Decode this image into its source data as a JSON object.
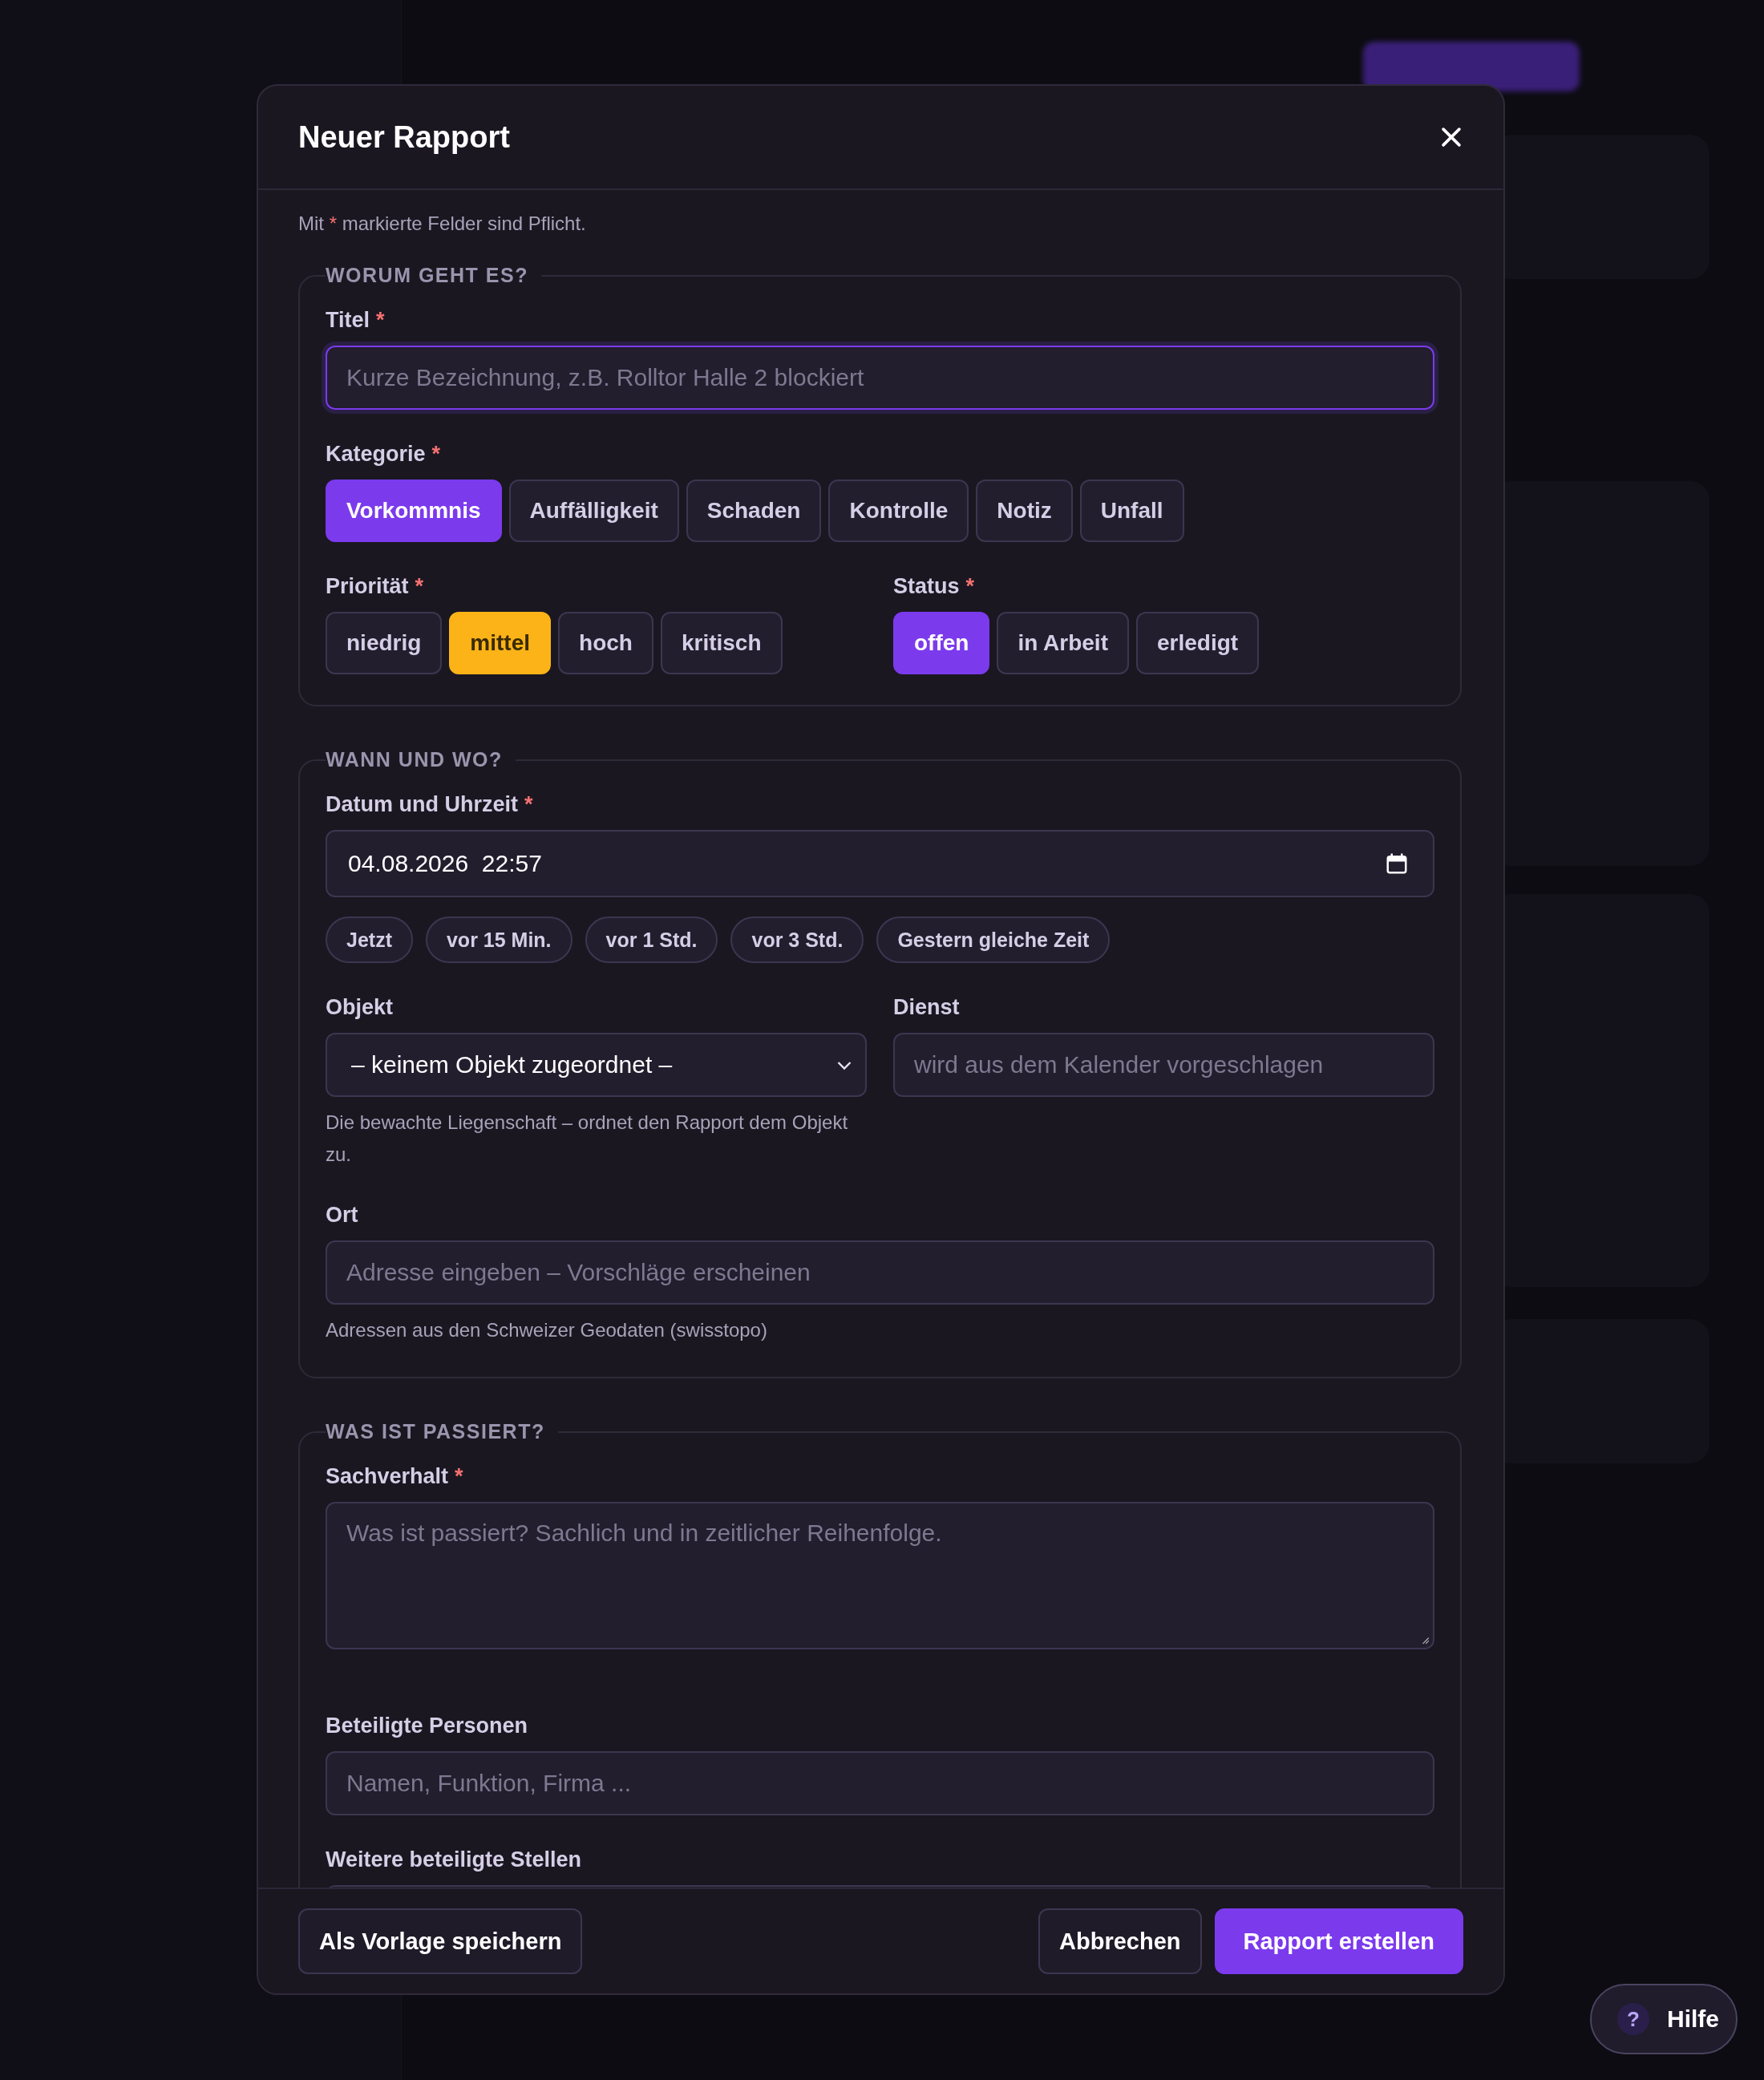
{
  "modal": {
    "title": "Neuer Rapport"
  },
  "required_note": {
    "before": "Mit",
    "mark": "*",
    "after": "markierte Felder sind Pflicht."
  },
  "sections": [
    {
      "legend": "WORUM GEHT ES?",
      "fields": [
        {
          "kind": "input",
          "label": "Titel",
          "required_mark": "*",
          "placeholder": "Kurze Bezeichnung, z.B. Rolltor Halle 2 blockiert",
          "focused": true
        },
        {
          "kind": "chips",
          "label": "Kategorie",
          "required_mark": "*",
          "color": "#7c3aed",
          "options": [
            {
              "label": "Vorkommnis",
              "selected": true
            },
            {
              "label": "Auffälligkeit",
              "selected": false
            },
            {
              "label": "Schaden",
              "selected": false
            },
            {
              "label": "Kontrolle",
              "selected": false
            },
            {
              "label": "Notiz",
              "selected": false
            },
            {
              "label": "Unfall",
              "selected": false
            }
          ]
        },
        {
          "kind": "pair",
          "fields": [
            {
              "kind": "chips",
              "label": "Priorität",
              "required_mark": "*",
              "color": "#fbb318",
              "options": [
                {
                  "label": "niedrig",
                  "selected": false
                },
                {
                  "label": "mittel",
                  "selected": true
                },
                {
                  "label": "hoch",
                  "selected": false
                },
                {
                  "label": "kritisch",
                  "selected": false
                }
              ]
            },
            {
              "kind": "chips",
              "label": "Status",
              "required_mark": "*",
              "color": "#7c3aed",
              "options": [
                {
                  "label": "offen",
                  "selected": true
                },
                {
                  "label": "in Arbeit",
                  "selected": false
                },
                {
                  "label": "erledigt",
                  "selected": false
                }
              ]
            }
          ]
        }
      ]
    },
    {
      "legend": "WANN UND WO?",
      "fields": [
        {
          "kind": "datetime",
          "label": "Datum und Uhrzeit",
          "required_mark": "*",
          "value": "04.08.2026  22:57",
          "presets": [
            "Jetzt",
            "vor 15 Min.",
            "vor 1 Std.",
            "vor 3 Std.",
            "Gestern gleiche Zeit"
          ]
        },
        {
          "kind": "pair",
          "fields": [
            {
              "kind": "select",
              "label": "Objekt",
              "value": "– keinem Objekt zugeordnet –",
              "hint": "Die bewachte Liegenschaft – ordnet den Rapport dem Objekt zu."
            },
            {
              "kind": "input",
              "label": "Dienst",
              "placeholder": "wird aus dem Kalender vorgeschlagen",
              "focused": false
            }
          ]
        },
        {
          "kind": "input",
          "label": "Ort",
          "placeholder": "Adresse eingeben – Vorschläge erscheinen",
          "hint": "Adressen aus den Schweizer Geodaten (swisstopo)",
          "focused": false
        }
      ]
    },
    {
      "legend": "WAS IST PASSIERT?",
      "fields": [
        {
          "kind": "textarea",
          "label": "Sachverhalt",
          "required_mark": "*",
          "placeholder": "Was ist passiert? Sachlich und in zeitlicher Reihenfolge."
        },
        {
          "kind": "input",
          "label": "Beteiligte Personen",
          "placeholder": "Namen, Funktion, Firma ...",
          "focused": false
        },
        {
          "kind": "input",
          "label": "Weitere beteiligte Stellen",
          "focused": false
        }
      ]
    }
  ],
  "footer": {
    "left_buttons": [
      {
        "label": "Als Vorlage speichern",
        "kind": "secondary"
      }
    ],
    "right_buttons": [
      {
        "label": "Abbrechen",
        "kind": "secondary"
      },
      {
        "label": "Rapport erstellen",
        "kind": "primary"
      }
    ]
  },
  "help": {
    "icon_text": "?",
    "label": "Hilfe"
  }
}
